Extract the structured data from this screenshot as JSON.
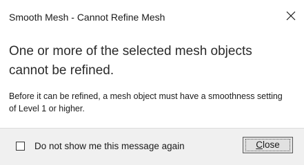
{
  "dialog": {
    "title": "Smooth Mesh - Cannot Refine Mesh",
    "close_icon": "close-x-icon",
    "main_instruction": "One or more of the selected mesh objects cannot be refined.",
    "content": "Before it can be refined, a mesh object must have a smoothness setting of Level 1 or higher.",
    "footer": {
      "checkbox_label": "Do not show me this message again",
      "checkbox_checked": false,
      "close_button_accel": "C",
      "close_button_rest": "lose"
    }
  },
  "colors": {
    "background": "#ffffff",
    "footer_background": "#f0f0f0",
    "button_face": "#e1e1e1",
    "text": "#1a1a1a"
  }
}
